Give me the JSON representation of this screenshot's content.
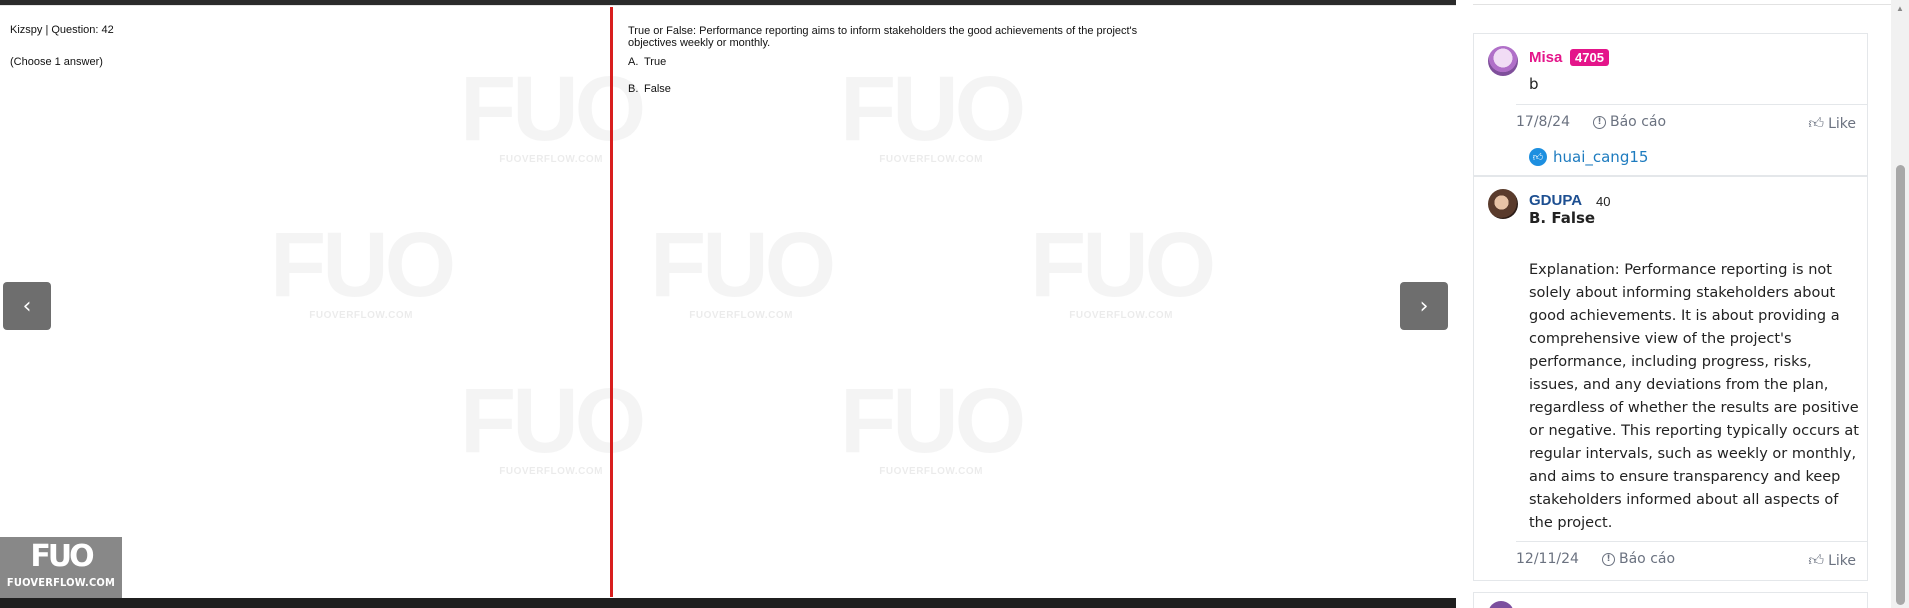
{
  "question": {
    "meta": "Kizspy | Question: 42",
    "instruction": "(Choose 1 answer)",
    "text": "True or False: Performance reporting aims to inform stakeholders the good achievements of the project's objectives weekly or monthly.",
    "options": [
      {
        "letter": "A.",
        "label": "True"
      },
      {
        "letter": "B.",
        "label": "False"
      }
    ]
  },
  "watermark": {
    "mark": "FUO",
    "site": "FUOVERFLOW.COM"
  },
  "logo": {
    "mark": "FUO",
    "text": "FUOVERFLOW.COM"
  },
  "nav": {
    "prev": "‹",
    "next": "›"
  },
  "comments": [
    {
      "user": "Misa",
      "badge": "4705",
      "body": "b",
      "date": "17/8/24",
      "report": "Báo cáo",
      "like": "Like",
      "liked_by": "huai_cang15"
    },
    {
      "user": "GDUPA",
      "points": "40",
      "answer": "B. False",
      "explanation": "Explanation: Performance reporting is not solely about informing stakeholders about good achievements. It is about providing a comprehensive view of the project's performance, including progress, risks, issues, and any deviations from the plan, regardless of whether the results are positive or negative. This reporting typically occurs at regular intervals, such as weekly or monthly, and aims to ensure transparency and keep stakeholders informed about all aspects of the project.",
      "date": "12/11/24",
      "report": "Báo cáo",
      "like": "Like"
    }
  ],
  "colors": {
    "divider": "#d81e1e",
    "username_pink": "#e4158a",
    "username_blue": "#1d4f91",
    "link_blue": "#1d7bbf"
  }
}
